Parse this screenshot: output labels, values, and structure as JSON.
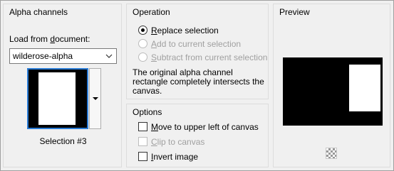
{
  "alpha_channels": {
    "title": "Alpha channels",
    "load_label_pre": "Load from ",
    "load_label_u": "d",
    "load_label_post": "ocument:",
    "document_value": "wilderose-alpha",
    "selection_caption": "Selection #3"
  },
  "operation": {
    "title": "Operation",
    "options": [
      {
        "u": "R",
        "rest": "eplace selection",
        "checked": true,
        "disabled": false
      },
      {
        "u": "A",
        "rest": "dd to current selection",
        "checked": false,
        "disabled": true
      },
      {
        "u": "S",
        "rest": "ubtract from current selection",
        "checked": false,
        "disabled": true
      }
    ],
    "info": "The original alpha channel rectangle completely intersects the canvas."
  },
  "options": {
    "title": "Options",
    "items": [
      {
        "u": "M",
        "rest": "ove to upper left of canvas",
        "checked": false,
        "disabled": false
      },
      {
        "u": "C",
        "rest": "lip to canvas",
        "checked": false,
        "disabled": true
      },
      {
        "u": "I",
        "rest": "nvert image",
        "checked": false,
        "disabled": false
      }
    ]
  },
  "preview": {
    "title": "Preview",
    "toggle_icon": "checkerboard-icon"
  },
  "colors": {
    "focus_border": "#2a7bd5",
    "disabled_text": "#a0a0a0"
  }
}
